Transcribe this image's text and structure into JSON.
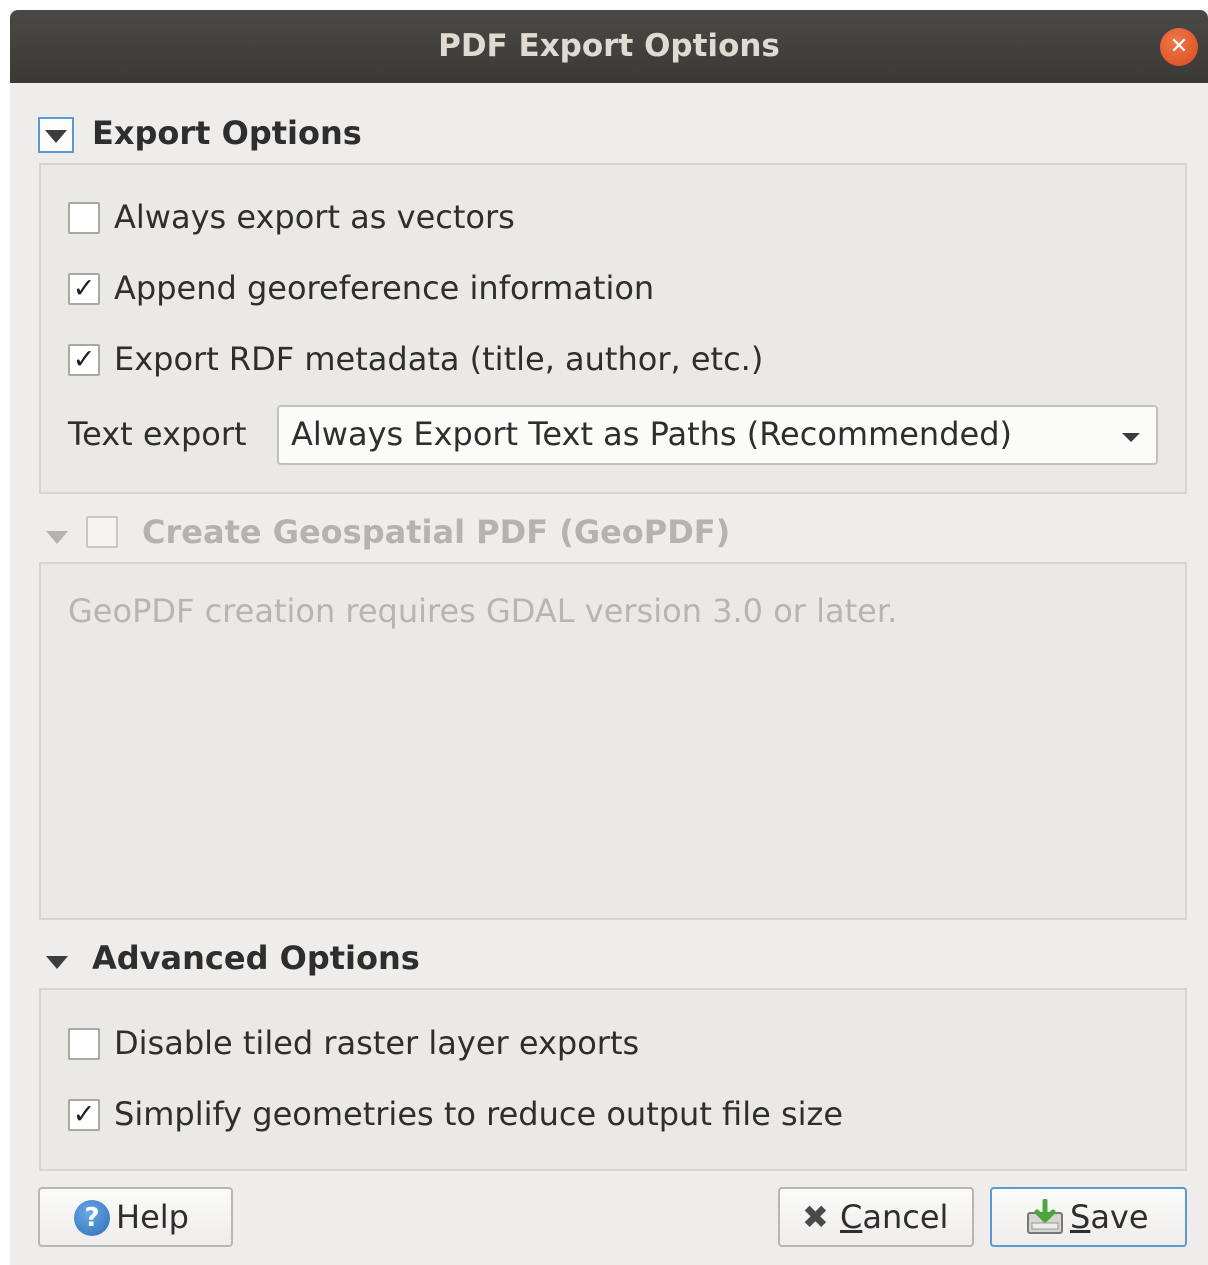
{
  "window": {
    "title": "PDF Export Options"
  },
  "export_options": {
    "title": "Export Options",
    "items": [
      {
        "label": "Always export as vectors",
        "checked": false
      },
      {
        "label": "Append georeference information",
        "checked": true
      },
      {
        "label": "Export RDF metadata (title, author, etc.)",
        "checked": true
      }
    ],
    "text_export_label": "Text export",
    "text_export_value": "Always Export Text as Paths (Recommended)"
  },
  "geopdf": {
    "title": "Create Geospatial PDF (GeoPDF)",
    "checked": false,
    "enabled": false,
    "message": "GeoPDF creation requires GDAL version 3.0 or later."
  },
  "advanced_options": {
    "title": "Advanced Options",
    "items": [
      {
        "label": "Disable tiled raster layer exports",
        "checked": false
      },
      {
        "label": "Simplify geometries to reduce output file size",
        "checked": true
      }
    ]
  },
  "buttons": {
    "help": "Help",
    "cancel": "Cancel",
    "save": "Save"
  },
  "check_glyph": "✓",
  "colors": {
    "accent": "#5a9bd5",
    "close": "#e35d2b",
    "titlebar": "#3f3e3b"
  }
}
